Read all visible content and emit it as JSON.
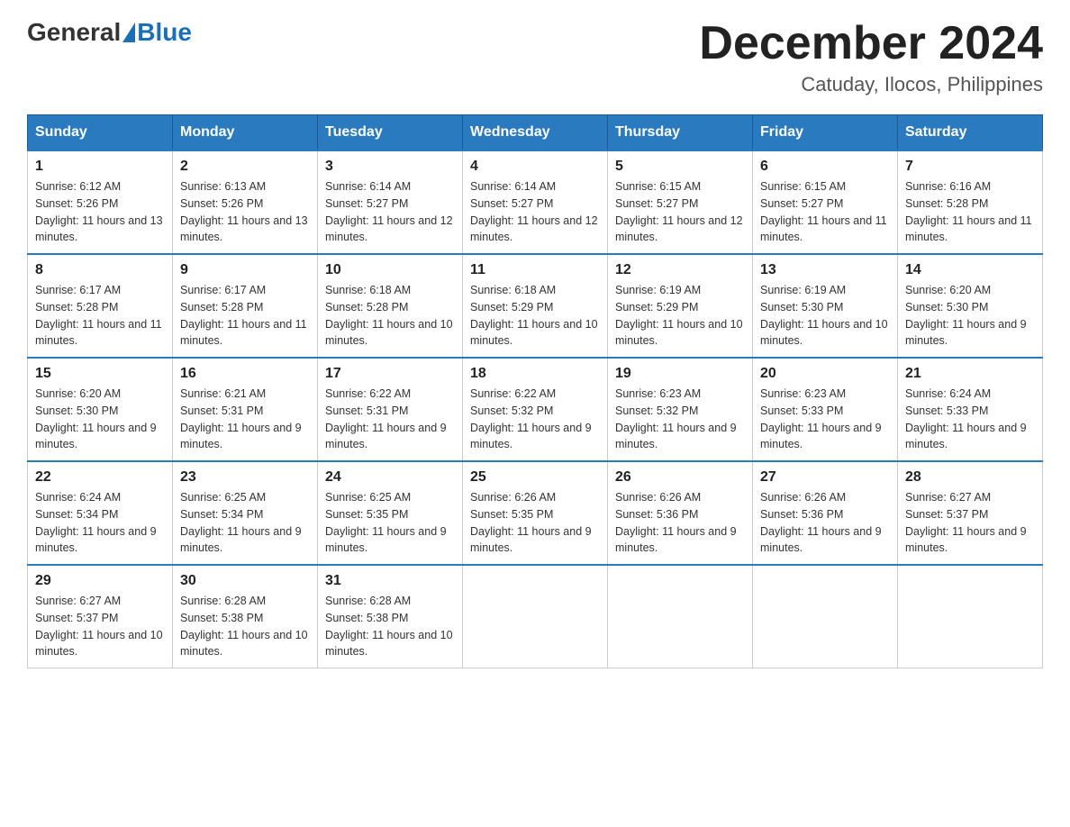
{
  "header": {
    "logo": {
      "general": "General",
      "blue": "Blue"
    },
    "title": "December 2024",
    "location": "Catuday, Ilocos, Philippines"
  },
  "calendar": {
    "days_of_week": [
      "Sunday",
      "Monday",
      "Tuesday",
      "Wednesday",
      "Thursday",
      "Friday",
      "Saturday"
    ],
    "weeks": [
      [
        {
          "day": "1",
          "sunrise": "6:12 AM",
          "sunset": "5:26 PM",
          "daylight": "11 hours and 13 minutes."
        },
        {
          "day": "2",
          "sunrise": "6:13 AM",
          "sunset": "5:26 PM",
          "daylight": "11 hours and 13 minutes."
        },
        {
          "day": "3",
          "sunrise": "6:14 AM",
          "sunset": "5:27 PM",
          "daylight": "11 hours and 12 minutes."
        },
        {
          "day": "4",
          "sunrise": "6:14 AM",
          "sunset": "5:27 PM",
          "daylight": "11 hours and 12 minutes."
        },
        {
          "day": "5",
          "sunrise": "6:15 AM",
          "sunset": "5:27 PM",
          "daylight": "11 hours and 12 minutes."
        },
        {
          "day": "6",
          "sunrise": "6:15 AM",
          "sunset": "5:27 PM",
          "daylight": "11 hours and 11 minutes."
        },
        {
          "day": "7",
          "sunrise": "6:16 AM",
          "sunset": "5:28 PM",
          "daylight": "11 hours and 11 minutes."
        }
      ],
      [
        {
          "day": "8",
          "sunrise": "6:17 AM",
          "sunset": "5:28 PM",
          "daylight": "11 hours and 11 minutes."
        },
        {
          "day": "9",
          "sunrise": "6:17 AM",
          "sunset": "5:28 PM",
          "daylight": "11 hours and 11 minutes."
        },
        {
          "day": "10",
          "sunrise": "6:18 AM",
          "sunset": "5:28 PM",
          "daylight": "11 hours and 10 minutes."
        },
        {
          "day": "11",
          "sunrise": "6:18 AM",
          "sunset": "5:29 PM",
          "daylight": "11 hours and 10 minutes."
        },
        {
          "day": "12",
          "sunrise": "6:19 AM",
          "sunset": "5:29 PM",
          "daylight": "11 hours and 10 minutes."
        },
        {
          "day": "13",
          "sunrise": "6:19 AM",
          "sunset": "5:30 PM",
          "daylight": "11 hours and 10 minutes."
        },
        {
          "day": "14",
          "sunrise": "6:20 AM",
          "sunset": "5:30 PM",
          "daylight": "11 hours and 9 minutes."
        }
      ],
      [
        {
          "day": "15",
          "sunrise": "6:20 AM",
          "sunset": "5:30 PM",
          "daylight": "11 hours and 9 minutes."
        },
        {
          "day": "16",
          "sunrise": "6:21 AM",
          "sunset": "5:31 PM",
          "daylight": "11 hours and 9 minutes."
        },
        {
          "day": "17",
          "sunrise": "6:22 AM",
          "sunset": "5:31 PM",
          "daylight": "11 hours and 9 minutes."
        },
        {
          "day": "18",
          "sunrise": "6:22 AM",
          "sunset": "5:32 PM",
          "daylight": "11 hours and 9 minutes."
        },
        {
          "day": "19",
          "sunrise": "6:23 AM",
          "sunset": "5:32 PM",
          "daylight": "11 hours and 9 minutes."
        },
        {
          "day": "20",
          "sunrise": "6:23 AM",
          "sunset": "5:33 PM",
          "daylight": "11 hours and 9 minutes."
        },
        {
          "day": "21",
          "sunrise": "6:24 AM",
          "sunset": "5:33 PM",
          "daylight": "11 hours and 9 minutes."
        }
      ],
      [
        {
          "day": "22",
          "sunrise": "6:24 AM",
          "sunset": "5:34 PM",
          "daylight": "11 hours and 9 minutes."
        },
        {
          "day": "23",
          "sunrise": "6:25 AM",
          "sunset": "5:34 PM",
          "daylight": "11 hours and 9 minutes."
        },
        {
          "day": "24",
          "sunrise": "6:25 AM",
          "sunset": "5:35 PM",
          "daylight": "11 hours and 9 minutes."
        },
        {
          "day": "25",
          "sunrise": "6:26 AM",
          "sunset": "5:35 PM",
          "daylight": "11 hours and 9 minutes."
        },
        {
          "day": "26",
          "sunrise": "6:26 AM",
          "sunset": "5:36 PM",
          "daylight": "11 hours and 9 minutes."
        },
        {
          "day": "27",
          "sunrise": "6:26 AM",
          "sunset": "5:36 PM",
          "daylight": "11 hours and 9 minutes."
        },
        {
          "day": "28",
          "sunrise": "6:27 AM",
          "sunset": "5:37 PM",
          "daylight": "11 hours and 9 minutes."
        }
      ],
      [
        {
          "day": "29",
          "sunrise": "6:27 AM",
          "sunset": "5:37 PM",
          "daylight": "11 hours and 10 minutes."
        },
        {
          "day": "30",
          "sunrise": "6:28 AM",
          "sunset": "5:38 PM",
          "daylight": "11 hours and 10 minutes."
        },
        {
          "day": "31",
          "sunrise": "6:28 AM",
          "sunset": "5:38 PM",
          "daylight": "11 hours and 10 minutes."
        },
        null,
        null,
        null,
        null
      ]
    ]
  }
}
